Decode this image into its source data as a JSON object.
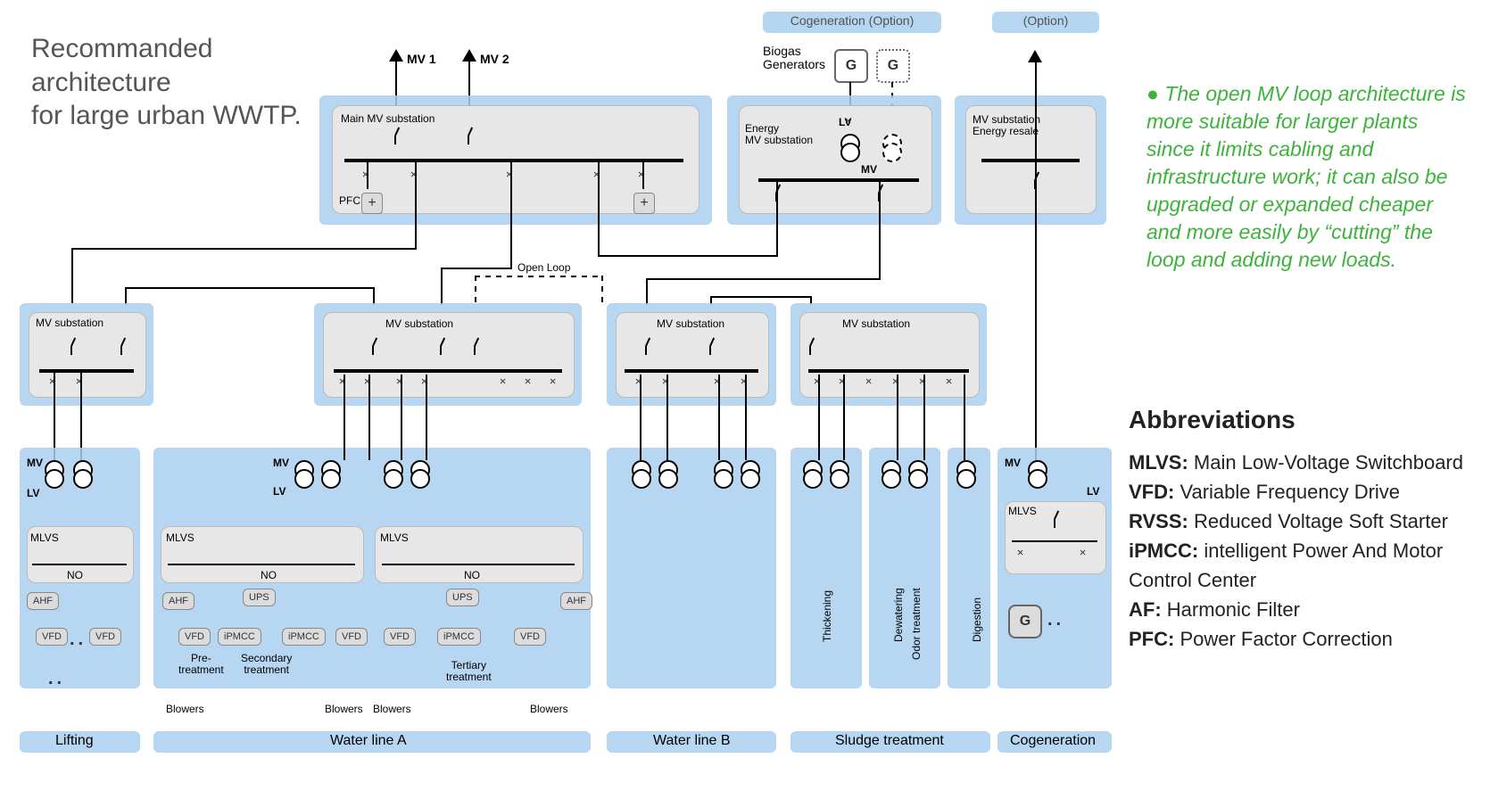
{
  "title": "Recommanded architecture\nfor large urban WWTP.",
  "callout": "The open MV loop architecture is more suitable for larger plants since it limits cabling and infrastructure work; it can also be upgraded or expanded cheaper and more easily by “cutting” the loop and adding new loads.",
  "abbr_heading": "Abbreviations",
  "abbr": [
    {
      "t": "MLVS:",
      "d": " Main Low-Voltage Switchboard"
    },
    {
      "t": "VFD:",
      "d": " Variable Frequency Drive"
    },
    {
      "t": "RVSS:",
      "d": " Reduced Voltage Soft Starter"
    },
    {
      "t": "iPMCC:",
      "d": " intelligent Power And Motor Control Center"
    },
    {
      "t": "AF:",
      "d": " Harmonic Filter"
    },
    {
      "t": "PFC:",
      "d": " Power Factor Correction"
    }
  ],
  "headers": {
    "cogen": "Cogeneration (Option)",
    "option": "(Option)"
  },
  "labels": {
    "mv1": "MV 1",
    "mv2": "MV 2",
    "biogas_gen": "Biogas\nGenerators",
    "main_mv": "Main MV substation",
    "energy_mv": "Energy\nMV substation",
    "mv_resale": "MV substation\nEnergy resale",
    "mv_sub": "MV substation",
    "open_loop": "Open Loop",
    "mlvs": "MLVS",
    "mv": "MV",
    "lv": "LV",
    "no": "NO",
    "ahf": "AHF",
    "ups": "UPS",
    "vfd": "VFD",
    "ipmcc": "iPMCC",
    "pfc": "PFC",
    "g": "G",
    "pre": "Pre-\ntreatment",
    "secondary": "Secondary\ntreatment",
    "tertiary": "Tertiary\ntreatment",
    "blowers": "Blowers",
    "thickening": "Thickening",
    "dewatering": "Dewatering",
    "odor": "Odor treatment",
    "digestion": "Digestion"
  },
  "sections": {
    "lifting": "Lifting",
    "wlA": "Water line A",
    "wlB": "Water line B",
    "sludge": "Sludge treatment",
    "cogen": "Cogeneration"
  }
}
